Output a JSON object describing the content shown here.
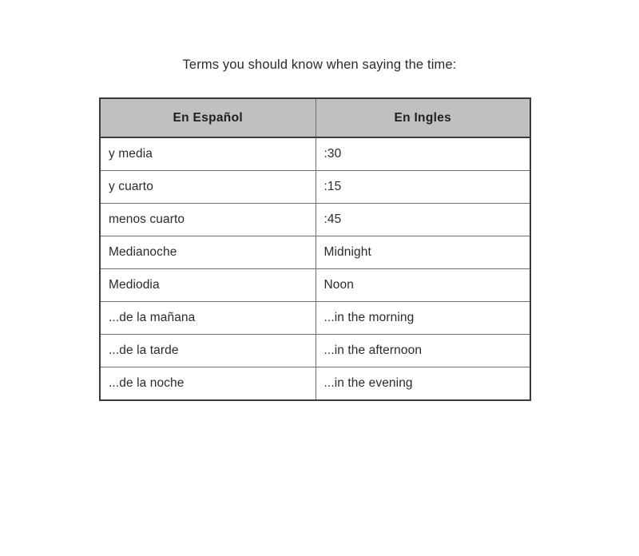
{
  "document": {
    "title": "Terms you should know when saying the time:",
    "background_color": "#ffffff",
    "text_color": "#2b2b2b"
  },
  "table": {
    "name": "spanish-time-terms-table",
    "header_background_color": "#c0c0c0",
    "border_color": "#3a3a3a",
    "inner_border_color": "#6e6e6e",
    "columns": [
      {
        "key": "es",
        "label": "En Español"
      },
      {
        "key": "en",
        "label": "En Ingles"
      }
    ],
    "rows": [
      {
        "es": "y media",
        "en": ":30"
      },
      {
        "es": "y cuarto",
        "en": ":15"
      },
      {
        "es": "menos cuarto",
        "en": ":45"
      },
      {
        "es": "Medianoche",
        "en": "Midnight"
      },
      {
        "es": "Mediodia",
        "en": "Noon"
      },
      {
        "es": "...de la mañana",
        "en": "...in the morning"
      },
      {
        "es": "...de la tarde",
        "en": "...in the afternoon"
      },
      {
        "es": "...de la noche",
        "en": "...in the evening"
      }
    ]
  }
}
